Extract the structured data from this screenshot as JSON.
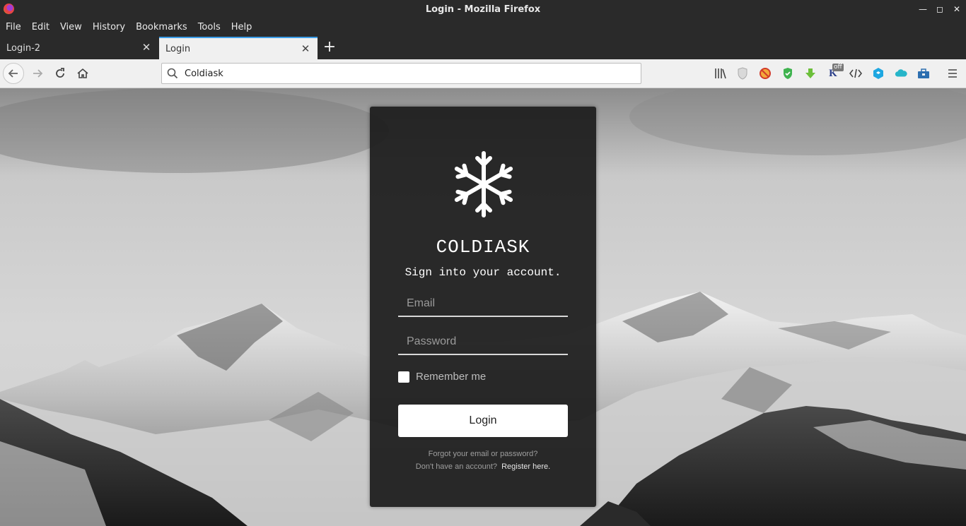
{
  "window": {
    "title": "Login - Mozilla Firefox"
  },
  "menu": [
    "File",
    "Edit",
    "View",
    "History",
    "Bookmarks",
    "Tools",
    "Help"
  ],
  "tabs": [
    {
      "label": "Login-2",
      "active": false
    },
    {
      "label": "Login",
      "active": true
    }
  ],
  "address_bar": {
    "value": "Coldiask"
  },
  "toolbar_icons": [
    "library-icon",
    "privacy-badger-icon",
    "blocker-icon",
    "shield-check-icon",
    "download-icon",
    "k-extension-icon",
    "devtools-icon",
    "cube-icon",
    "cloud-icon",
    "toolbox-icon",
    "hamburger-menu-icon"
  ],
  "extension_badge": "off",
  "login_card": {
    "brand": "COLDIASK",
    "subtitle": "Sign into your account.",
    "email_placeholder": "Email",
    "password_placeholder": "Password",
    "remember_label": "Remember me",
    "remember_checked": false,
    "login_button": "Login",
    "forgot_link": "Forgot your email or password?",
    "no_account_text": "Don't have an account?",
    "register_link": "Register here."
  },
  "colors": {
    "accent_tab": "#3b9de8",
    "card_bg": "#1c1c1c",
    "button_bg": "#ffffff"
  }
}
